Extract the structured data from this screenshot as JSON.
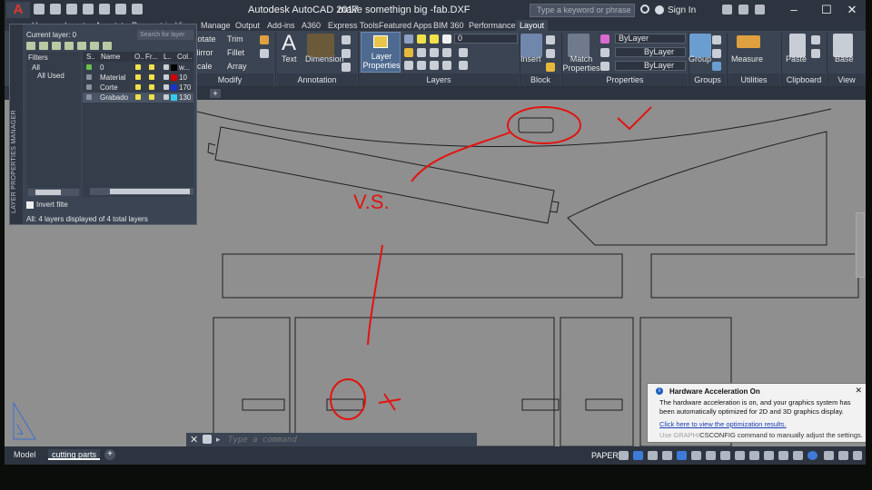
{
  "title": {
    "app": "Autodesk AutoCAD 2017",
    "document": "make somethign big -fab.DXF",
    "search_placeholder": "Type a keyword or phrase",
    "signin": "Sign In"
  },
  "tabs": [
    {
      "label": "Home"
    },
    {
      "label": "Insert"
    },
    {
      "label": "Annotate"
    },
    {
      "label": "Parametric"
    },
    {
      "label": "View"
    },
    {
      "label": "Manage"
    },
    {
      "label": "Output"
    },
    {
      "label": "Add-ins"
    },
    {
      "label": "A360"
    },
    {
      "label": "Express Tools"
    },
    {
      "label": "Featured Apps"
    },
    {
      "label": "BIM 360"
    },
    {
      "label": "Performance"
    },
    {
      "label": "Layout"
    }
  ],
  "ribbon": {
    "modify": {
      "rotate": "Rotate",
      "trim": "Trim",
      "mirror": "Mirror",
      "fillet": "Fillet",
      "scale": "Scale",
      "array": "Array",
      "panel": "Modify"
    },
    "annotation": {
      "text": "Text",
      "dimension": "Dimension",
      "panel": "Annotation"
    },
    "layers": {
      "layer_properties": "Layer Properties",
      "current_layer": "0",
      "panel": "Layers"
    },
    "block": {
      "insert": "Insert",
      "panel": "Block"
    },
    "properties": {
      "match": "Match Properties",
      "color": "ByLayer",
      "linetype": "ByLayer",
      "lineweight": "ByLayer",
      "panel": "Properties"
    },
    "groups": {
      "group": "Group",
      "panel": "Groups"
    },
    "utilities": {
      "measure": "Measure",
      "panel": "Utilities"
    },
    "clipboard": {
      "paste": "Paste",
      "panel": "Clipboard"
    },
    "view": {
      "base": "Base",
      "panel": "View"
    }
  },
  "layer_palette": {
    "vertical_title": "LAYER PROPERTIES MANAGER",
    "current_layer": "Current layer: 0",
    "search_placeholder": "Search for layer",
    "filters_header": "Filters",
    "filter_all": "All",
    "filter_used": "All Used",
    "columns": [
      "S..",
      "Name",
      "O..",
      "Fr...",
      "L..",
      "Col.."
    ],
    "layers": [
      {
        "name": "0",
        "color": "#000000",
        "color_label": "w..."
      },
      {
        "name": "Material",
        "color": "#cc0000",
        "color_label": "10"
      },
      {
        "name": "Corte",
        "color": "#1a33cc",
        "color_label": "170"
      },
      {
        "name": "Grabado",
        "color": "#33ccee",
        "color_label": "130"
      }
    ],
    "invert_filter": "Invert filte",
    "status": "All: 4 layers displayed of 4 total layers"
  },
  "annotations": {
    "vs": "V.S."
  },
  "command_line": {
    "placeholder": "Type a command"
  },
  "status_bar": {
    "tab_model": "Model",
    "tab_layout": "cutting parts",
    "paper": "PAPER"
  },
  "notification": {
    "title": "Hardware Acceleration On",
    "body": "The hardware acceleration is on, and your graphics system has been automatically optimized for 2D and 3D graphics display.",
    "link": "Click here to view the optimization results.",
    "tail_prefix": "Use GRAPHI",
    "tail_rest": "CSCONFIG command to manually adjust the settings."
  },
  "colors": {
    "ui_dark": "#2d3440",
    "ui_main": "#3b4453",
    "canvas": "#8f8f8f",
    "annotation_red": "#e2140f"
  }
}
